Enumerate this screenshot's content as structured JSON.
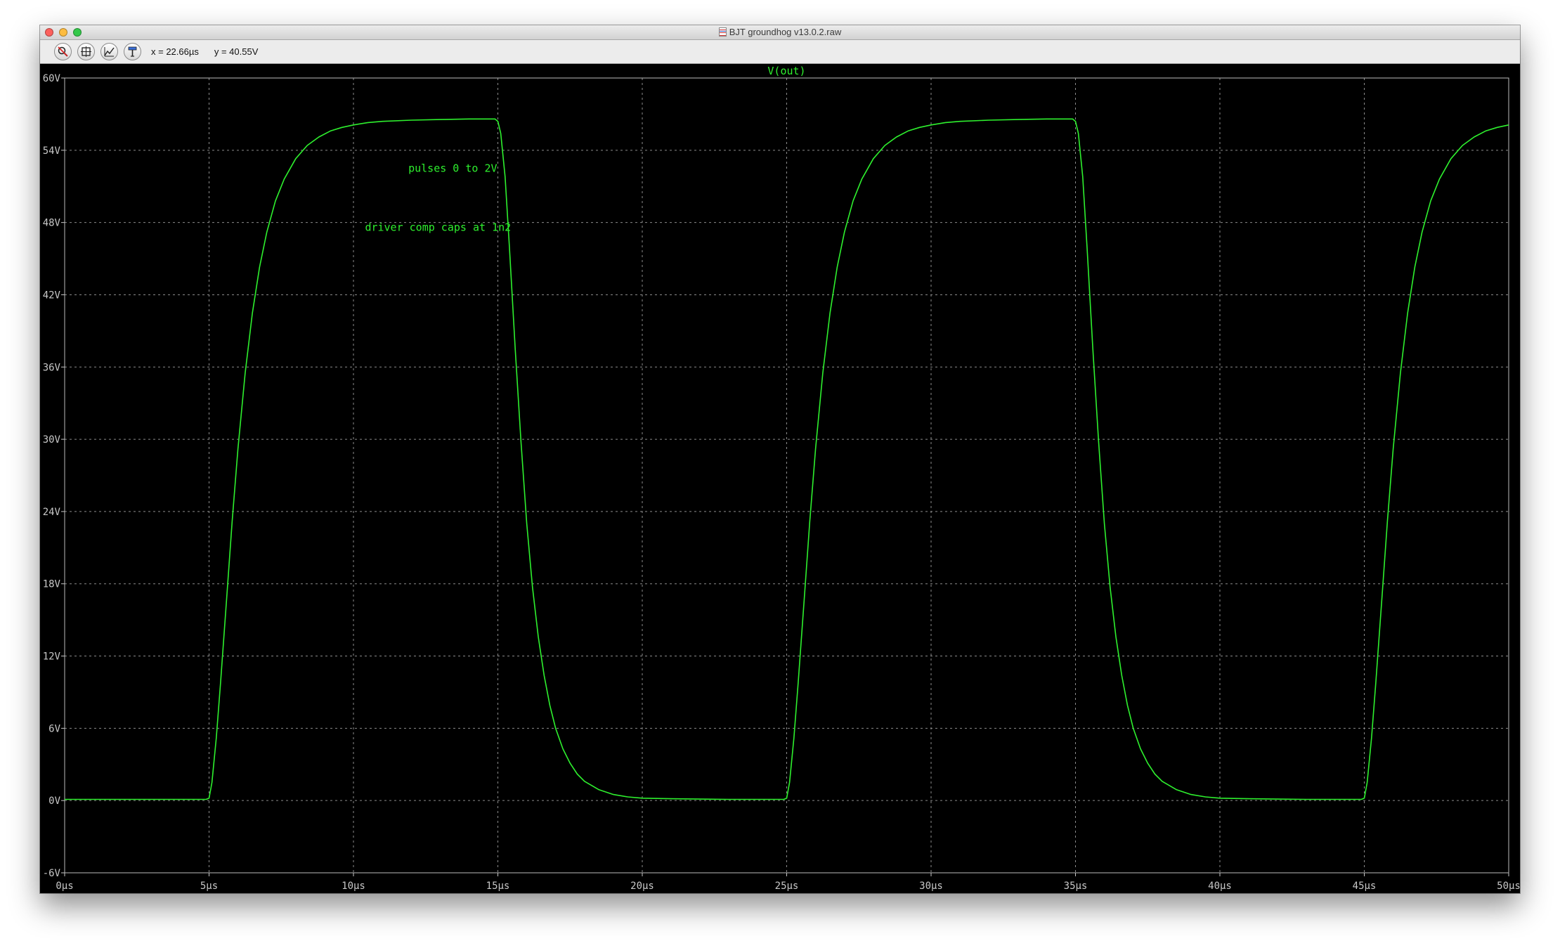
{
  "window": {
    "title": "BJT groundhog v13.0.2.raw",
    "background_color": "#000000",
    "grid_color": "#8c8c8c",
    "trace_color": "#2ef02e",
    "axis_text_color": "#c8c8c8"
  },
  "toolbar": {
    "buttons": [
      {
        "icon": "zoom-cancel-icon"
      },
      {
        "icon": "autorange-icon"
      },
      {
        "icon": "zoom-fit-icon"
      },
      {
        "icon": "probe-icon"
      }
    ],
    "cursor_x": "x = 22.66µs",
    "cursor_y": "y = 40.55V"
  },
  "chart_data": {
    "type": "line",
    "title": "V(out)",
    "xlabel": "",
    "ylabel": "",
    "xlim": [
      0,
      50
    ],
    "ylim": [
      -6,
      60
    ],
    "x_unit": "µs",
    "y_unit": "V",
    "grid": true,
    "x_ticks": [
      "0µs",
      "5µs",
      "10µs",
      "15µs",
      "20µs",
      "25µs",
      "30µs",
      "35µs",
      "40µs",
      "45µs",
      "50µs"
    ],
    "y_ticks": [
      "60V",
      "54V",
      "48V",
      "42V",
      "36V",
      "30V",
      "24V",
      "18V",
      "12V",
      "6V",
      "0V",
      "-6V"
    ],
    "annotations": [
      {
        "text": "pulses 0 to 2V",
        "x": 11.9,
        "y": 52.2
      },
      {
        "text": "driver comp caps at 1n2",
        "x": 10.4,
        "y": 47.3
      }
    ],
    "series": [
      {
        "name": "V(out)",
        "color": "#2ef02e",
        "x": [
          0,
          4.9,
          5.0,
          5.1,
          5.25,
          5.4,
          5.6,
          5.8,
          6.0,
          6.25,
          6.5,
          6.75,
          7.0,
          7.3,
          7.6,
          8.0,
          8.4,
          8.8,
          9.2,
          9.6,
          10.0,
          10.5,
          11.0,
          12.0,
          13.0,
          14.0,
          14.9,
          15.0,
          15.1,
          15.25,
          15.4,
          15.6,
          15.8,
          16.0,
          16.2,
          16.4,
          16.6,
          16.8,
          17.0,
          17.25,
          17.5,
          17.75,
          18.0,
          18.5,
          19.0,
          19.5,
          20.0,
          21.0,
          22.0,
          23.0,
          24.0,
          24.9,
          25.0,
          25.1,
          25.25,
          25.4,
          25.6,
          25.8,
          26.0,
          26.25,
          26.5,
          26.75,
          27.0,
          27.3,
          27.6,
          28.0,
          28.4,
          28.8,
          29.2,
          29.6,
          30.0,
          30.5,
          31.0,
          32.0,
          33.0,
          34.0,
          34.9,
          35.0,
          35.1,
          35.25,
          35.4,
          35.6,
          35.8,
          36.0,
          36.2,
          36.4,
          36.6,
          36.8,
          37.0,
          37.25,
          37.5,
          37.75,
          38.0,
          38.5,
          39.0,
          39.5,
          40.0,
          41.0,
          42.0,
          43.0,
          44.0,
          44.9,
          45.0,
          45.1,
          45.25,
          45.4,
          45.6,
          45.8,
          46.0,
          46.25,
          46.5,
          46.75,
          47.0,
          47.3,
          47.6,
          48.0,
          48.4,
          48.8,
          49.2,
          49.6,
          50.0
        ],
        "y": [
          0.1,
          0.1,
          0.2,
          1.5,
          5.2,
          9.8,
          16.5,
          23.2,
          29.2,
          35.5,
          40.5,
          44.3,
          47.2,
          49.8,
          51.6,
          53.3,
          54.4,
          55.1,
          55.6,
          55.9,
          56.1,
          56.3,
          56.4,
          56.5,
          56.55,
          56.6,
          56.6,
          56.4,
          55.4,
          51.8,
          46.0,
          37.5,
          29.8,
          23.0,
          17.7,
          13.6,
          10.4,
          7.9,
          6.0,
          4.3,
          3.1,
          2.2,
          1.6,
          0.9,
          0.5,
          0.3,
          0.2,
          0.15,
          0.12,
          0.1,
          0.1,
          0.1,
          0.2,
          1.5,
          5.2,
          9.8,
          16.5,
          23.2,
          29.2,
          35.5,
          40.5,
          44.3,
          47.2,
          49.8,
          51.6,
          53.3,
          54.4,
          55.1,
          55.6,
          55.9,
          56.1,
          56.3,
          56.4,
          56.5,
          56.55,
          56.6,
          56.6,
          56.4,
          55.4,
          51.8,
          46.0,
          37.5,
          29.8,
          23.0,
          17.7,
          13.6,
          10.4,
          7.9,
          6.0,
          4.3,
          3.1,
          2.2,
          1.6,
          0.9,
          0.5,
          0.3,
          0.2,
          0.15,
          0.12,
          0.1,
          0.1,
          0.1,
          0.2,
          1.5,
          5.2,
          9.8,
          16.5,
          23.2,
          29.2,
          35.5,
          40.5,
          44.3,
          47.2,
          49.8,
          51.6,
          53.3,
          54.4,
          55.1,
          55.6,
          55.9,
          56.1
        ]
      }
    ]
  }
}
